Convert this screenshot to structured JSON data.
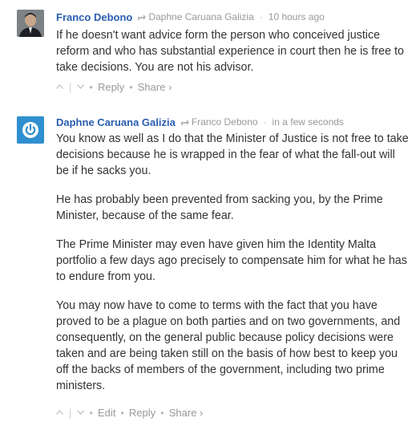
{
  "comments": [
    {
      "author": "Franco Debono",
      "reply_to": "Daphne Caruana Galizia",
      "timestamp": "10 hours ago",
      "avatar_icon": "user-photo",
      "paragraphs": [
        "If he doesn't want advice form the person who conceived justice reform and who has substantial experience in court then he is free to take decisions. You are not his advisor."
      ],
      "actions": {
        "reply": "Reply",
        "share": "Share ›"
      }
    },
    {
      "author": "Daphne Caruana Galizia",
      "reply_to": "Franco Debono",
      "timestamp": "in a few seconds",
      "avatar_icon": "power-logo-icon",
      "paragraphs": [
        "You know as well as I do that the Minister of Justice is not free to take decisions because he is wrapped in the fear of what the fall-out will be if he sacks you.",
        "He has probably been prevented from sacking you, by the Prime Minister, because of the same fear.",
        "The Prime Minister may even have given him the Identity Malta portfolio a few days ago precisely to compensate him for what he has to endure from you.",
        "You may now have to come to terms with the fact that you have proved to be a plague on both parties and on two governments, and consequently, on the general public because policy decisions were taken and are being taken still on the basis of how best to keep you off the backs of members of the government, including two prime ministers."
      ],
      "actions": {
        "edit": "Edit",
        "reply": "Reply",
        "share": "Share ›"
      }
    }
  ],
  "colors": {
    "author": "#2a5db0",
    "meta": "#999999",
    "text": "#333333",
    "avatar_blue": "#2f8fcf"
  }
}
